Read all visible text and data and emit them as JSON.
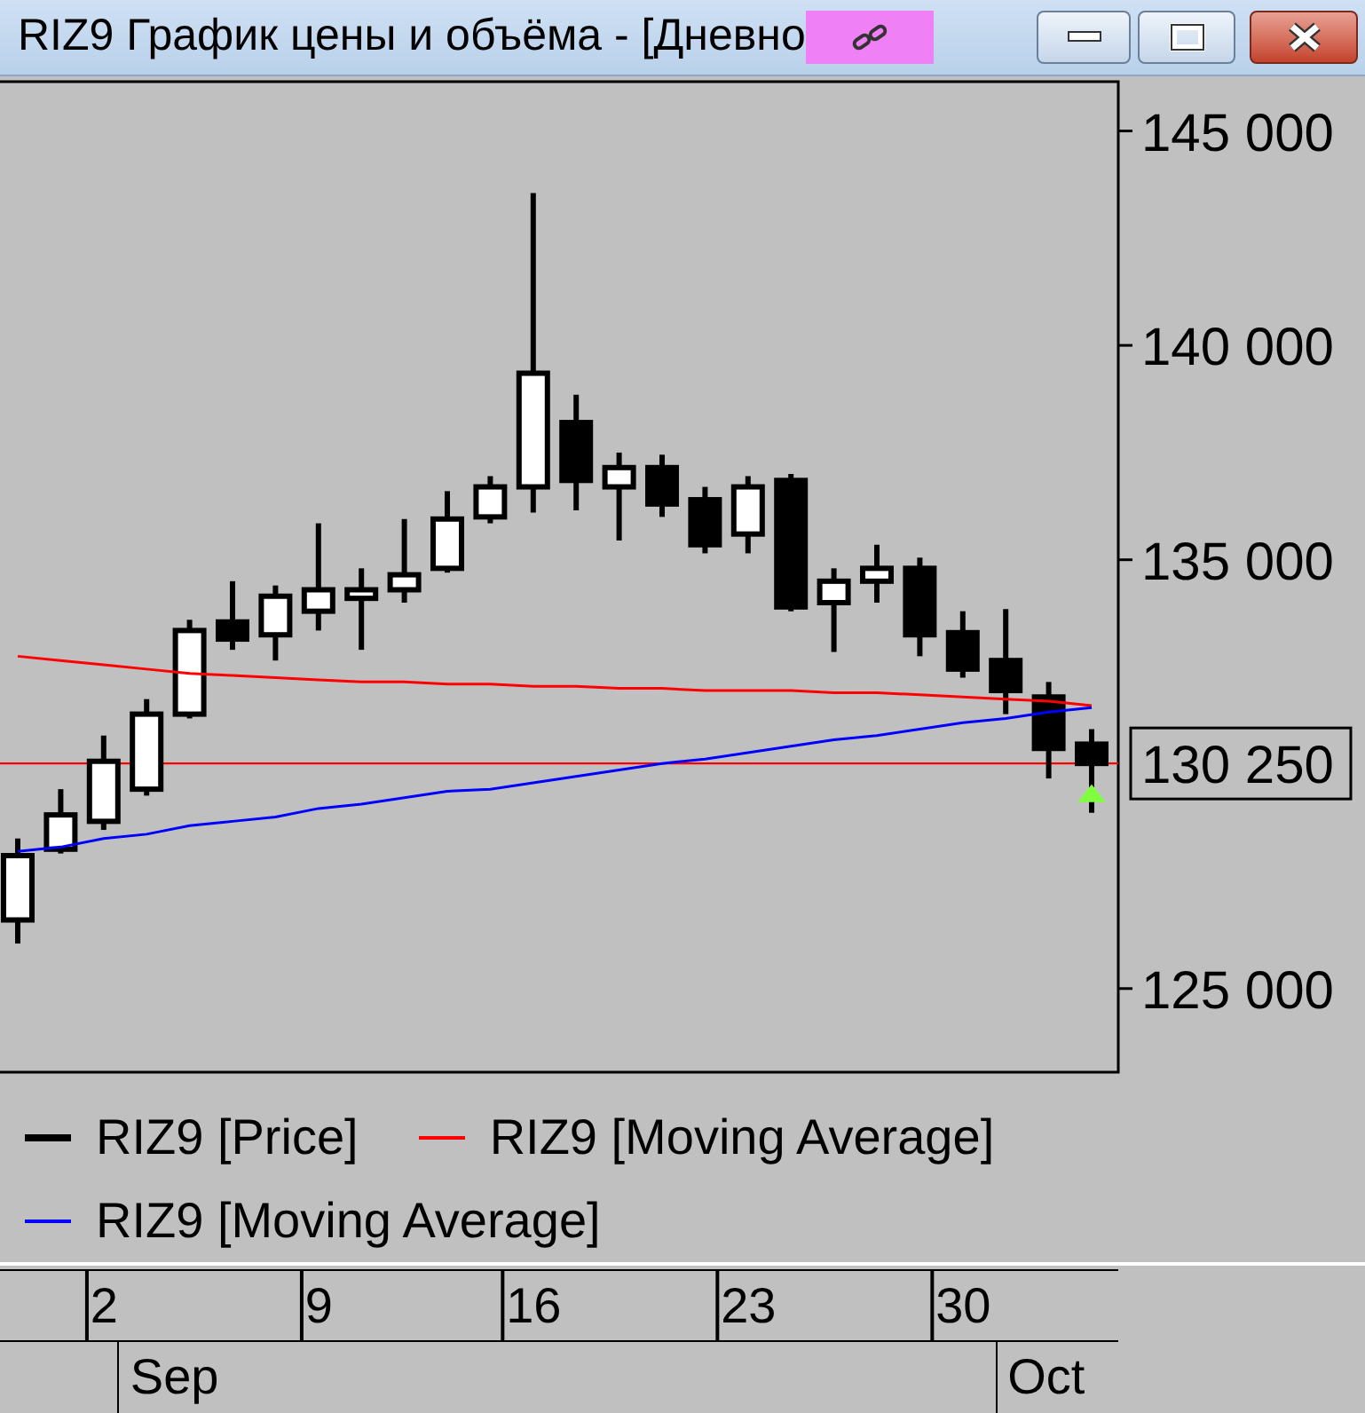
{
  "window": {
    "title": "RIZ9 График цены и объёма - [Дневно"
  },
  "chart": {
    "chart_data": {
      "type": "candlestick",
      "ylim": [
        123050,
        146150
      ],
      "categories": [
        null,
        null,
        "2",
        null,
        null,
        null,
        null,
        "9",
        null,
        null,
        null,
        null,
        "16",
        null,
        null,
        null,
        null,
        "23",
        null,
        null,
        null,
        null,
        "30",
        null,
        null,
        null
      ],
      "yticks": [
        {
          "value": 125000,
          "label": "125 000"
        },
        {
          "value": 135000,
          "label": "135 000"
        },
        {
          "value": 140000,
          "label": "140 000"
        },
        {
          "value": 145000,
          "label": "145 000"
        }
      ],
      "ohlc": [
        [
          126600,
          128500,
          126050,
          128100
        ],
        [
          128250,
          129650,
          128150,
          129050
        ],
        [
          128900,
          130900,
          128700,
          130300
        ],
        [
          129650,
          131750,
          129500,
          131400
        ],
        [
          131400,
          133600,
          131300,
          133350
        ],
        [
          133550,
          134500,
          132900,
          133150
        ],
        [
          133250,
          134400,
          132650,
          134150
        ],
        [
          133800,
          135850,
          133350,
          134300
        ],
        [
          134100,
          134800,
          132900,
          134300
        ],
        [
          134300,
          135950,
          134000,
          134650
        ],
        [
          134800,
          136600,
          134700,
          135950
        ],
        [
          136000,
          136950,
          135850,
          136700
        ],
        [
          136700,
          143550,
          136100,
          139350
        ],
        [
          138200,
          138850,
          136150,
          136850
        ],
        [
          136700,
          137500,
          135450,
          137150
        ],
        [
          137150,
          137450,
          136000,
          136300
        ],
        [
          136400,
          136700,
          135150,
          135350
        ],
        [
          135600,
          136950,
          135150,
          136700
        ],
        [
          136850,
          137000,
          133800,
          133900
        ],
        [
          134000,
          134800,
          132850,
          134500
        ],
        [
          134500,
          135350,
          134000,
          134800
        ],
        [
          134800,
          135050,
          132750,
          133250
        ],
        [
          133300,
          133800,
          132250,
          132450
        ],
        [
          132650,
          133850,
          131400,
          131950
        ],
        [
          131800,
          132150,
          129900,
          130600
        ],
        [
          130700,
          131050,
          129100,
          130250
        ]
      ],
      "series": [
        {
          "name": "RIZ9 [Moving Average]",
          "color": "#ff0000",
          "type": "line",
          "values": [
            132750,
            132650,
            132550,
            132450,
            132350,
            132300,
            132250,
            132200,
            132150,
            132150,
            132100,
            132100,
            132050,
            132050,
            132000,
            132000,
            131950,
            131950,
            131950,
            131900,
            131900,
            131850,
            131800,
            131750,
            131700,
            131600
          ]
        },
        {
          "name": "RIZ9 [Moving Average]",
          "color": "#0000ff",
          "type": "line",
          "values": [
            128200,
            128300,
            128500,
            128600,
            128800,
            128900,
            129000,
            129200,
            129300,
            129450,
            129600,
            129650,
            129800,
            129950,
            130100,
            130250,
            130350,
            130500,
            130650,
            130800,
            130900,
            131050,
            131200,
            131300,
            131450,
            131550
          ]
        }
      ],
      "ref_lines": [
        {
          "axis": "y",
          "value": 130250,
          "label": "130 250",
          "color": "#ff0000"
        }
      ]
    },
    "month_axis": [
      {
        "label": "Sep"
      },
      {
        "label": "Oct"
      }
    ],
    "price_legend": {
      "label": "RIZ9 [Price]",
      "color": "#000000"
    }
  }
}
